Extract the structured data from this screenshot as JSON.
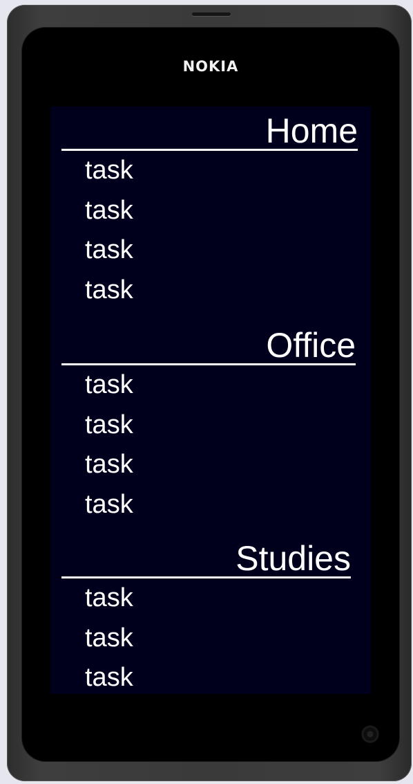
{
  "device": {
    "brand": "NOKIA"
  },
  "sections": [
    {
      "title": "Home",
      "tasks": [
        "task",
        "task",
        "task",
        "task"
      ]
    },
    {
      "title": "Office",
      "tasks": [
        "task",
        "task",
        "task",
        "task"
      ]
    },
    {
      "title": "Studies",
      "tasks": [
        "task",
        "task",
        "task"
      ]
    }
  ],
  "colors": {
    "screen_background": "#00001c",
    "text": "#ffffff",
    "phone_body": "#3a3a3a",
    "page_background": "#e6e6ee"
  },
  "icons": {
    "hardware_button": "camera-button-icon"
  }
}
